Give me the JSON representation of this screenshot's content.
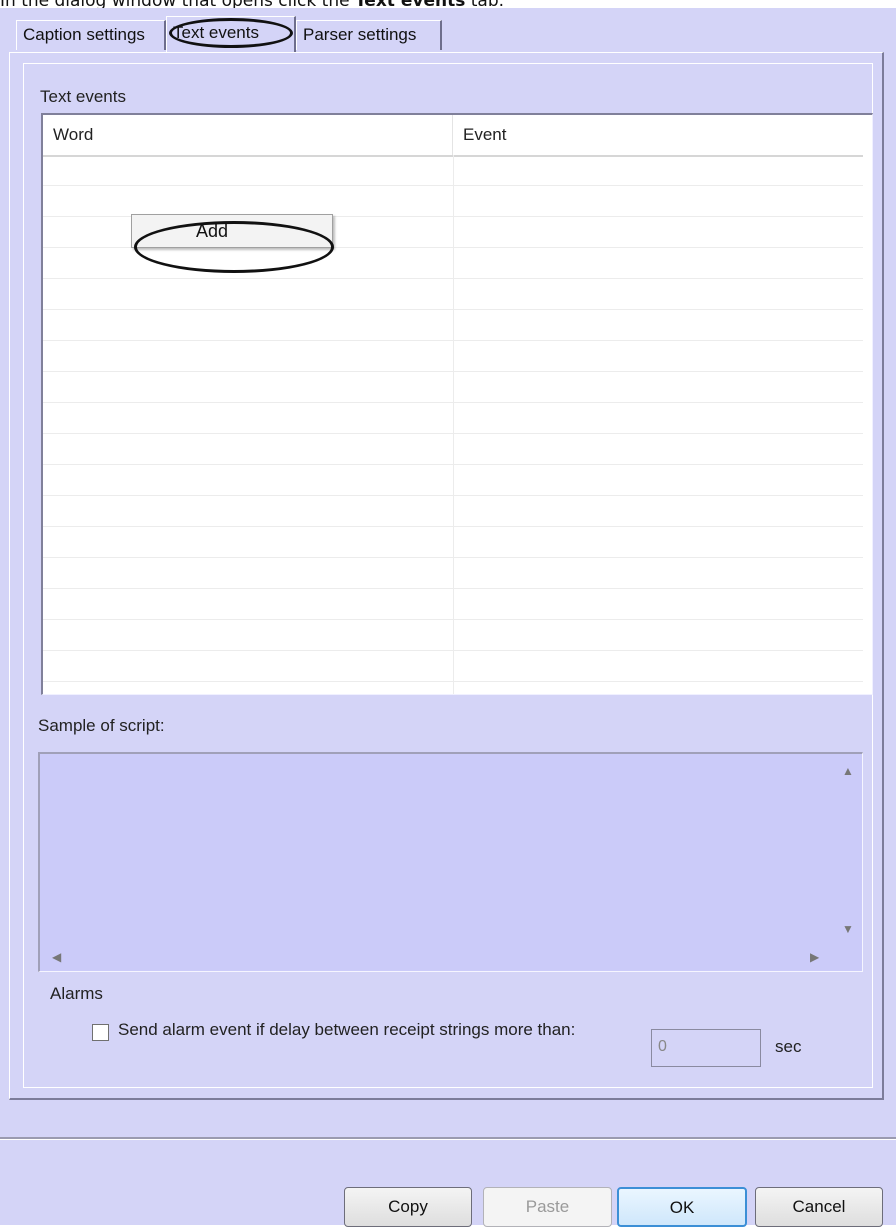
{
  "instruction": {
    "prefix": "In the dialog window that opens click the ",
    "emphasis": "Text events",
    "suffix": " tab."
  },
  "tabs": [
    {
      "label": "Caption settings",
      "active": false
    },
    {
      "label": "Text events",
      "active": true
    },
    {
      "label": "Parser settings",
      "active": false
    }
  ],
  "text_events": {
    "group_label": "Text events",
    "columns": [
      "Word",
      "Event"
    ],
    "rows": []
  },
  "context_menu": {
    "items": [
      "Add"
    ]
  },
  "script": {
    "label": "Sample of script:",
    "value": ""
  },
  "alarms": {
    "group_label": "Alarms",
    "checkbox_label": "Send alarm event if delay between receipt strings more than:",
    "checked": false,
    "delay_value": "0",
    "unit": "sec"
  },
  "buttons": {
    "copy": "Copy",
    "paste": "Paste",
    "ok": "OK",
    "cancel": "Cancel"
  }
}
